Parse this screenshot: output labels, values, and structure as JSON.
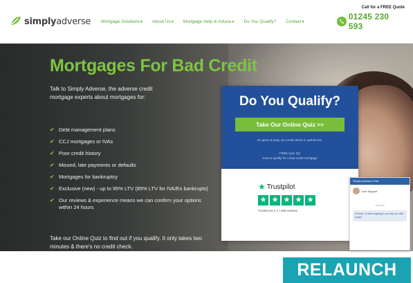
{
  "header": {
    "logo_simply": "simply",
    "logo_adverse": "adverse",
    "nav": [
      {
        "label": "Mortgage Solutions",
        "has_dropdown": true
      },
      {
        "label": "About Us",
        "has_dropdown": true
      },
      {
        "label": "Mortgage Help & Advice",
        "has_dropdown": true
      },
      {
        "label": "Do You Qualify?",
        "has_dropdown": false
      },
      {
        "label": "Contact",
        "has_dropdown": true
      }
    ],
    "call_label": "Call for a FREE Quote",
    "phone": "01245 230 593"
  },
  "hero": {
    "title": "Mortgages For Bad Credit",
    "intro": "Talk to Simply Adverse, the adverse credit mortgage experts about mortgages for:",
    "bullets": [
      "Debt management plans",
      "CCJ mortgages or IVAs",
      "Poor credit history",
      "Missed, late payments or defaults",
      "Mortgages for bankruptcy",
      "Exclusive (new) - up to 95% LTV (85% LTV for IVA/Ex bankrupts)",
      "Our reviews & experience means we can confirm your options within 24 hours"
    ],
    "cta": "Take our Online Quiz to find out if you qualify. It only takes two minutes & there's no credit check."
  },
  "qualify": {
    "title": "Do You Qualify?",
    "button": "Take Our Online Quiz >>",
    "note": "It's quick & easy. No credit check or upfront fee.",
    "small_line1": "FREE Quiz (Q)",
    "small_line2": "How to qualify for a bad credit mortgage"
  },
  "trustpilot": {
    "brand": "Trustpilot",
    "stars": 5,
    "text": "TrustScore 4.7 | 469 reviews"
  },
  "chat": {
    "header": "Simply Adverse Chat",
    "agent": "Live Support",
    "time": "Just now",
    "message": "Hi there. Is there anything I can help you with today?"
  },
  "badge": "RELAUNCH",
  "colors": {
    "brand_green": "#7dc443",
    "qualify_blue": "#23509a",
    "trustpilot_green": "#00b67a",
    "badge_teal": "#1aa3b3"
  }
}
